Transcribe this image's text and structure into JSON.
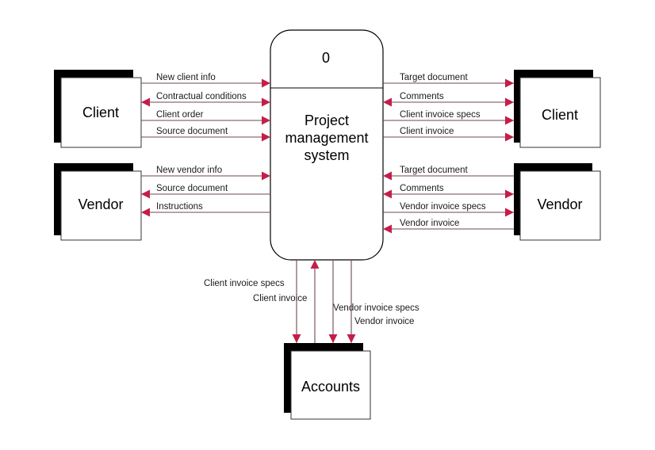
{
  "colors": {
    "arrowhead": "#c41e4a",
    "line": "#6b4a52",
    "shadow": "#000000"
  },
  "process": {
    "number": "0",
    "lines": [
      "Project",
      "management",
      "system"
    ]
  },
  "entities": {
    "client_left": "Client",
    "vendor_left": "Vendor",
    "client_right": "Client",
    "vendor_right": "Vendor",
    "accounts": "Accounts"
  },
  "flows_left_client": [
    {
      "label": "New client info",
      "direction": "to-process"
    },
    {
      "label": "Contractual conditions",
      "direction": "both"
    },
    {
      "label": "Client order",
      "direction": "to-process"
    },
    {
      "label": "Source document",
      "direction": "to-process"
    }
  ],
  "flows_left_vendor": [
    {
      "label": "New vendor info",
      "direction": "to-process"
    },
    {
      "label": "Source document",
      "direction": "to-entity"
    },
    {
      "label": "Instructions",
      "direction": "to-entity"
    }
  ],
  "flows_right_client": [
    {
      "label": "Target document",
      "direction": "to-entity"
    },
    {
      "label": "Comments",
      "direction": "both"
    },
    {
      "label": "Client invoice specs",
      "direction": "to-entity"
    },
    {
      "label": "Client invoice",
      "direction": "to-entity"
    }
  ],
  "flows_right_vendor": [
    {
      "label": "Target document",
      "direction": "to-process"
    },
    {
      "label": "Comments",
      "direction": "both"
    },
    {
      "label": "Vendor invoice specs",
      "direction": "to-entity"
    },
    {
      "label": "Vendor invoice",
      "direction": "to-process"
    }
  ],
  "flows_accounts": [
    {
      "label": "Client invoice specs",
      "direction": "to-entity"
    },
    {
      "label": "Client invoice",
      "direction": "to-process"
    },
    {
      "label": "Vendor invoice specs",
      "direction": "to-entity"
    },
    {
      "label": "Vendor invoice",
      "direction": "to-entity"
    }
  ]
}
